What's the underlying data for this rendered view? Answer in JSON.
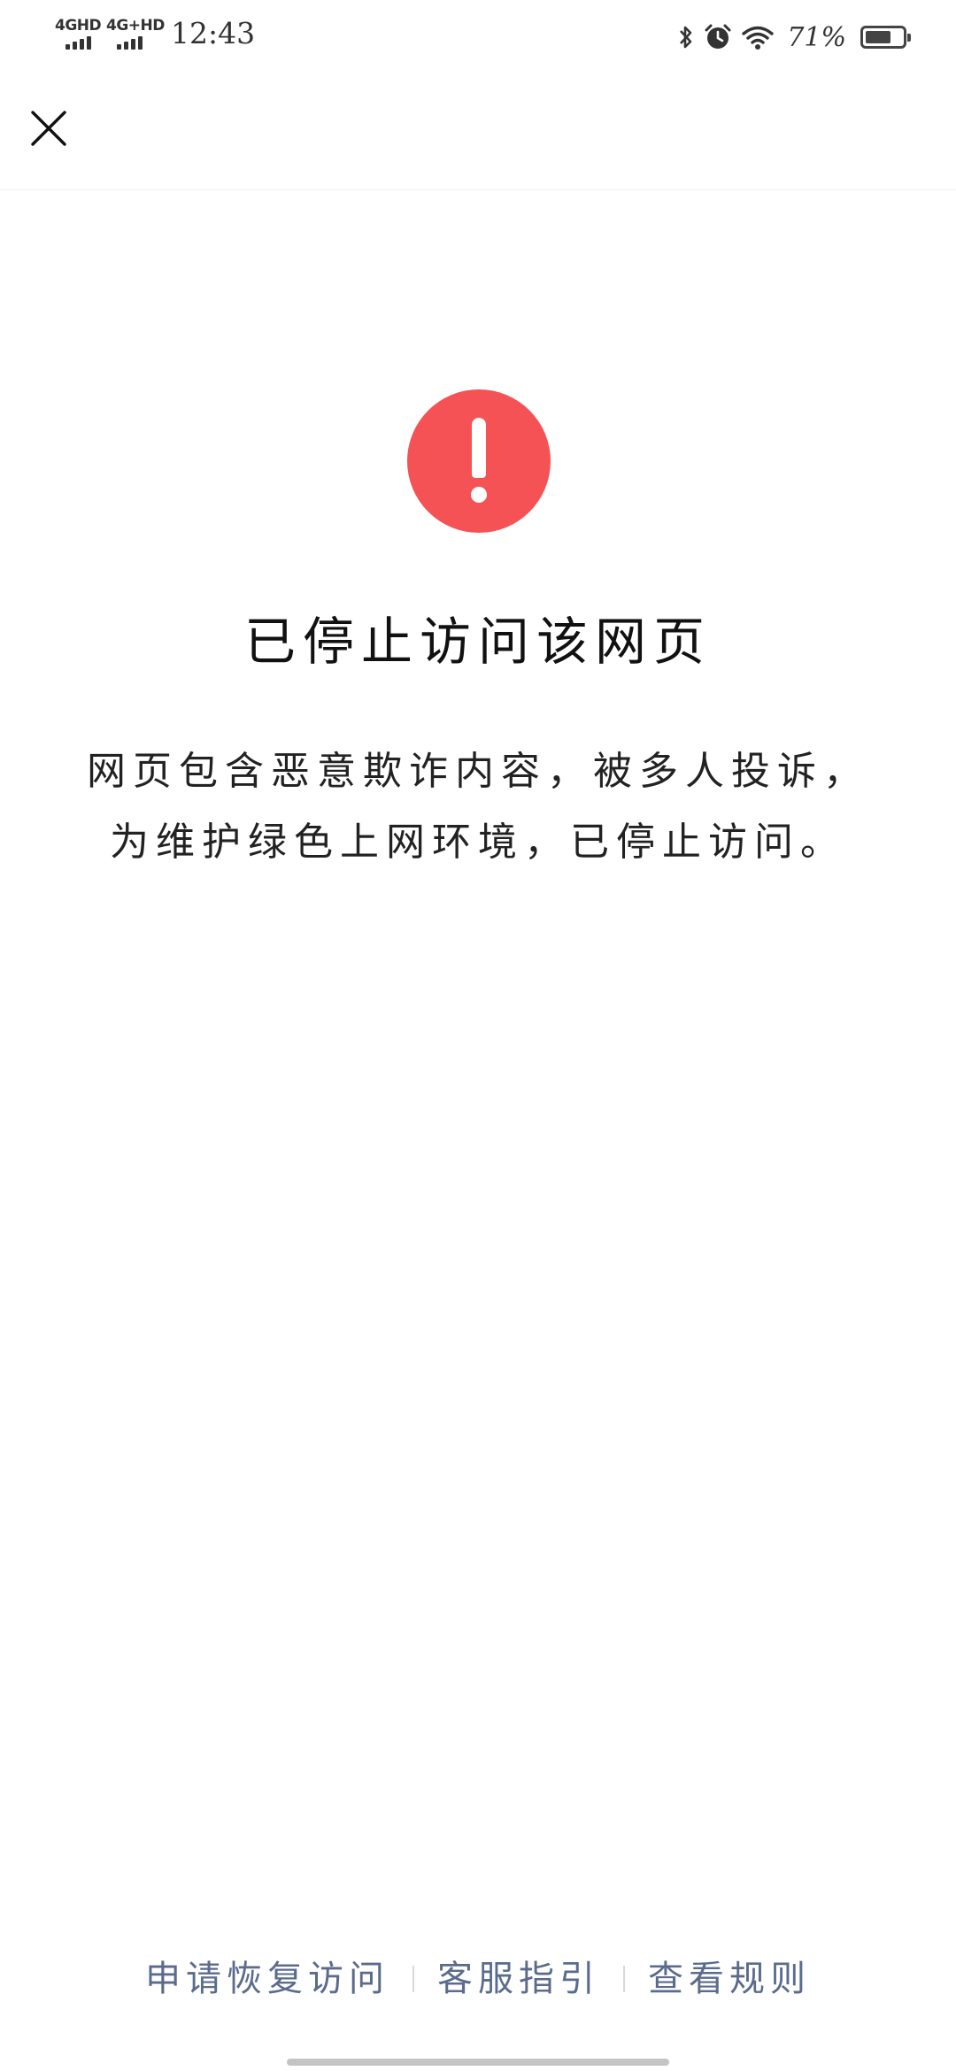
{
  "status_bar": {
    "net1": "4GHD",
    "net2": "4G+HD",
    "time": "12:43",
    "battery_percent": "71%",
    "battery_level": 0.71,
    "icons": [
      "bluetooth-icon",
      "alarm-icon",
      "wifi-icon",
      "battery-icon"
    ]
  },
  "nav": {
    "close_icon": "close-icon"
  },
  "main": {
    "alert_icon": "exclamation-icon",
    "alert_color": "#f55255",
    "title": "已停止访问该网页",
    "description_line1": "网页包含恶意欺诈内容，被多人投诉，",
    "description_line2": "为维护绿色上网环境，已停止访问。"
  },
  "footer": {
    "links": [
      {
        "label": "申请恢复访问"
      },
      {
        "label": "客服指引"
      },
      {
        "label": "查看规则"
      }
    ],
    "link_color": "#5b6b8c"
  }
}
